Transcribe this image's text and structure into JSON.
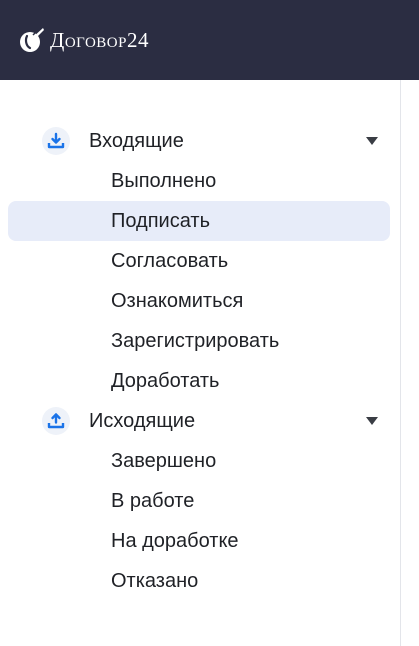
{
  "header": {
    "logo_text": "Договор24",
    "background": "#2b2d42"
  },
  "nav": {
    "accent": "#1a73e8",
    "active_bg": "#e7ecf9",
    "groups": [
      {
        "label": "Входящие",
        "icon": "inbox-download-icon",
        "expanded": true,
        "items": [
          {
            "label": "Выполнено"
          },
          {
            "label": "Подписать",
            "active": true
          },
          {
            "label": "Согласовать"
          },
          {
            "label": "Ознакомиться"
          },
          {
            "label": "Зарегистрировать"
          },
          {
            "label": "Доработать"
          }
        ]
      },
      {
        "label": "Исходящие",
        "icon": "outbox-upload-icon",
        "expanded": true,
        "items": [
          {
            "label": "Завершено"
          },
          {
            "label": "В работе"
          },
          {
            "label": "На доработке"
          },
          {
            "label": "Отказано"
          }
        ]
      }
    ]
  }
}
